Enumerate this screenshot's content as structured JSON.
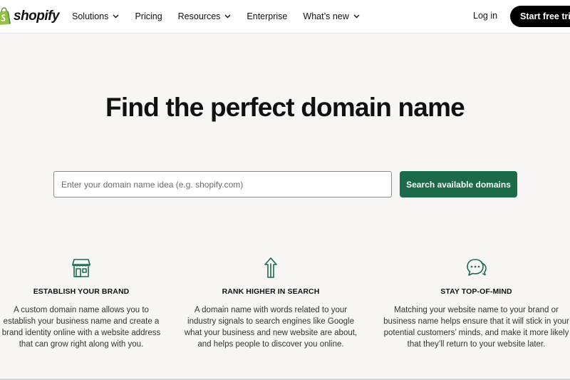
{
  "nav": {
    "logo_text": "shopify",
    "items": [
      {
        "label": "Solutions",
        "has_dropdown": true
      },
      {
        "label": "Pricing",
        "has_dropdown": false
      },
      {
        "label": "Resources",
        "has_dropdown": true
      },
      {
        "label": "Enterprise",
        "has_dropdown": false
      },
      {
        "label": "What’s new",
        "has_dropdown": true
      }
    ],
    "login_label": "Log in",
    "cta_label": "Start free trial"
  },
  "hero": {
    "title": "Find the perfect domain name",
    "search_placeholder": "Enter your domain name idea (e.g. shopify.com)",
    "search_value": "",
    "search_button_label": "Search available domains"
  },
  "features": [
    {
      "icon": "storefront-icon",
      "title": "ESTABLISH YOUR BRAND",
      "body": "A custom domain name allows you to establish your business name and create a brand identity online with a website address that can grow right along with you."
    },
    {
      "icon": "arrow-up-icon",
      "title": "RANK HIGHER IN SEARCH",
      "body": "A domain name with words related to your industry signals to search engines like Google what your business and new website are about, and helps people to discover you online."
    },
    {
      "icon": "chat-bubbles-icon",
      "title": "STAY TOP-OF-MIND",
      "body": "Matching your website name to your brand or business name helps ensure that it will stick in your potential customers’ minds, and make it more likely that they’ll return to your website later."
    }
  ],
  "colors": {
    "accent_green": "#1b6b4a",
    "icon_green": "#1b6b4a",
    "background": "#f7f6f4",
    "cta_black": "#000000"
  }
}
